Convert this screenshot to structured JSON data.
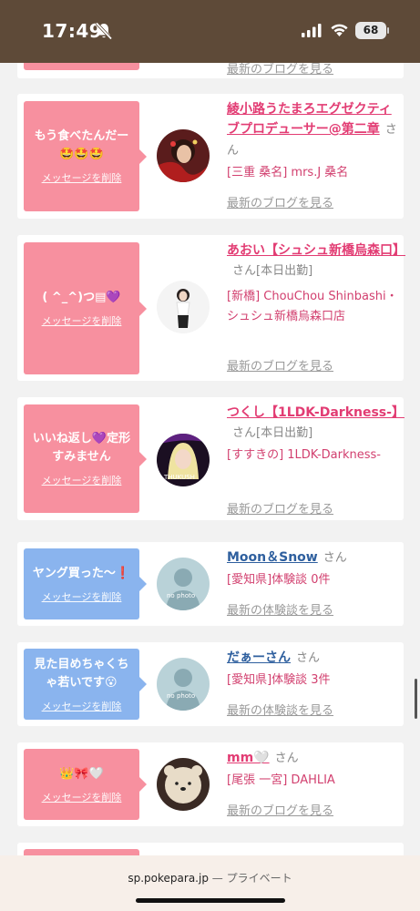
{
  "status": {
    "time": "17:49",
    "battery": "68"
  },
  "cards": [
    {
      "bubble": "",
      "delete": "",
      "name": "",
      "san": "",
      "shop": "",
      "blog": "最新のブログを見る"
    },
    {
      "bubble": "もう食べたんだー🤩🤩🤩",
      "delete": "メッセージを削除",
      "name": "綾小路うたまろエグゼクティブプロデューサー@第二章",
      "san": "さん",
      "shop": "[三重 桑名] mrs.J 桑名",
      "blog": "最新のブログを見る"
    },
    {
      "bubble": "( ^_^)つ▤💜",
      "delete": "メッセージを削除",
      "name": "あおい【シュシュ新橋烏森口】",
      "san": "さん[本日出勤]",
      "shop": "[新橋] ChouChou Shinbashi・シュシュ新橋烏森口店",
      "blog": "最新のブログを見る"
    },
    {
      "bubble": "いいね返し💜定形すみません",
      "delete": "メッセージを削除",
      "name": "つくし【1LDK-Darkness-】",
      "san": "さん[本日出勤]",
      "shop": "[すすきの] 1LDK-Darkness-",
      "blog": "最新のブログを見る"
    },
    {
      "bubble": "ヤング買った〜❗",
      "delete": "メッセージを削除",
      "name": "Moon＆Snow",
      "san": "さん",
      "shop": "[愛知県]体験談 0件",
      "blog": "最新の体験談を見る"
    },
    {
      "bubble": "見た目めちゃくちゃ若いです😮",
      "delete": "メッセージを削除",
      "name": "だぁーさん",
      "san": "さん",
      "shop": "[愛知県]体験談 3件",
      "blog": "最新の体験談を見る"
    },
    {
      "bubble": "👑🎀🤍",
      "delete": "メッセージを削除",
      "name": "mm🤍",
      "san": "さん",
      "shop": "[尾張 一宮] DAHLIA",
      "blog": "最新のブログを見る"
    }
  ],
  "browser": {
    "url": "sp.pokepara.jp",
    "separator": " — ",
    "mode": "プライベート"
  }
}
